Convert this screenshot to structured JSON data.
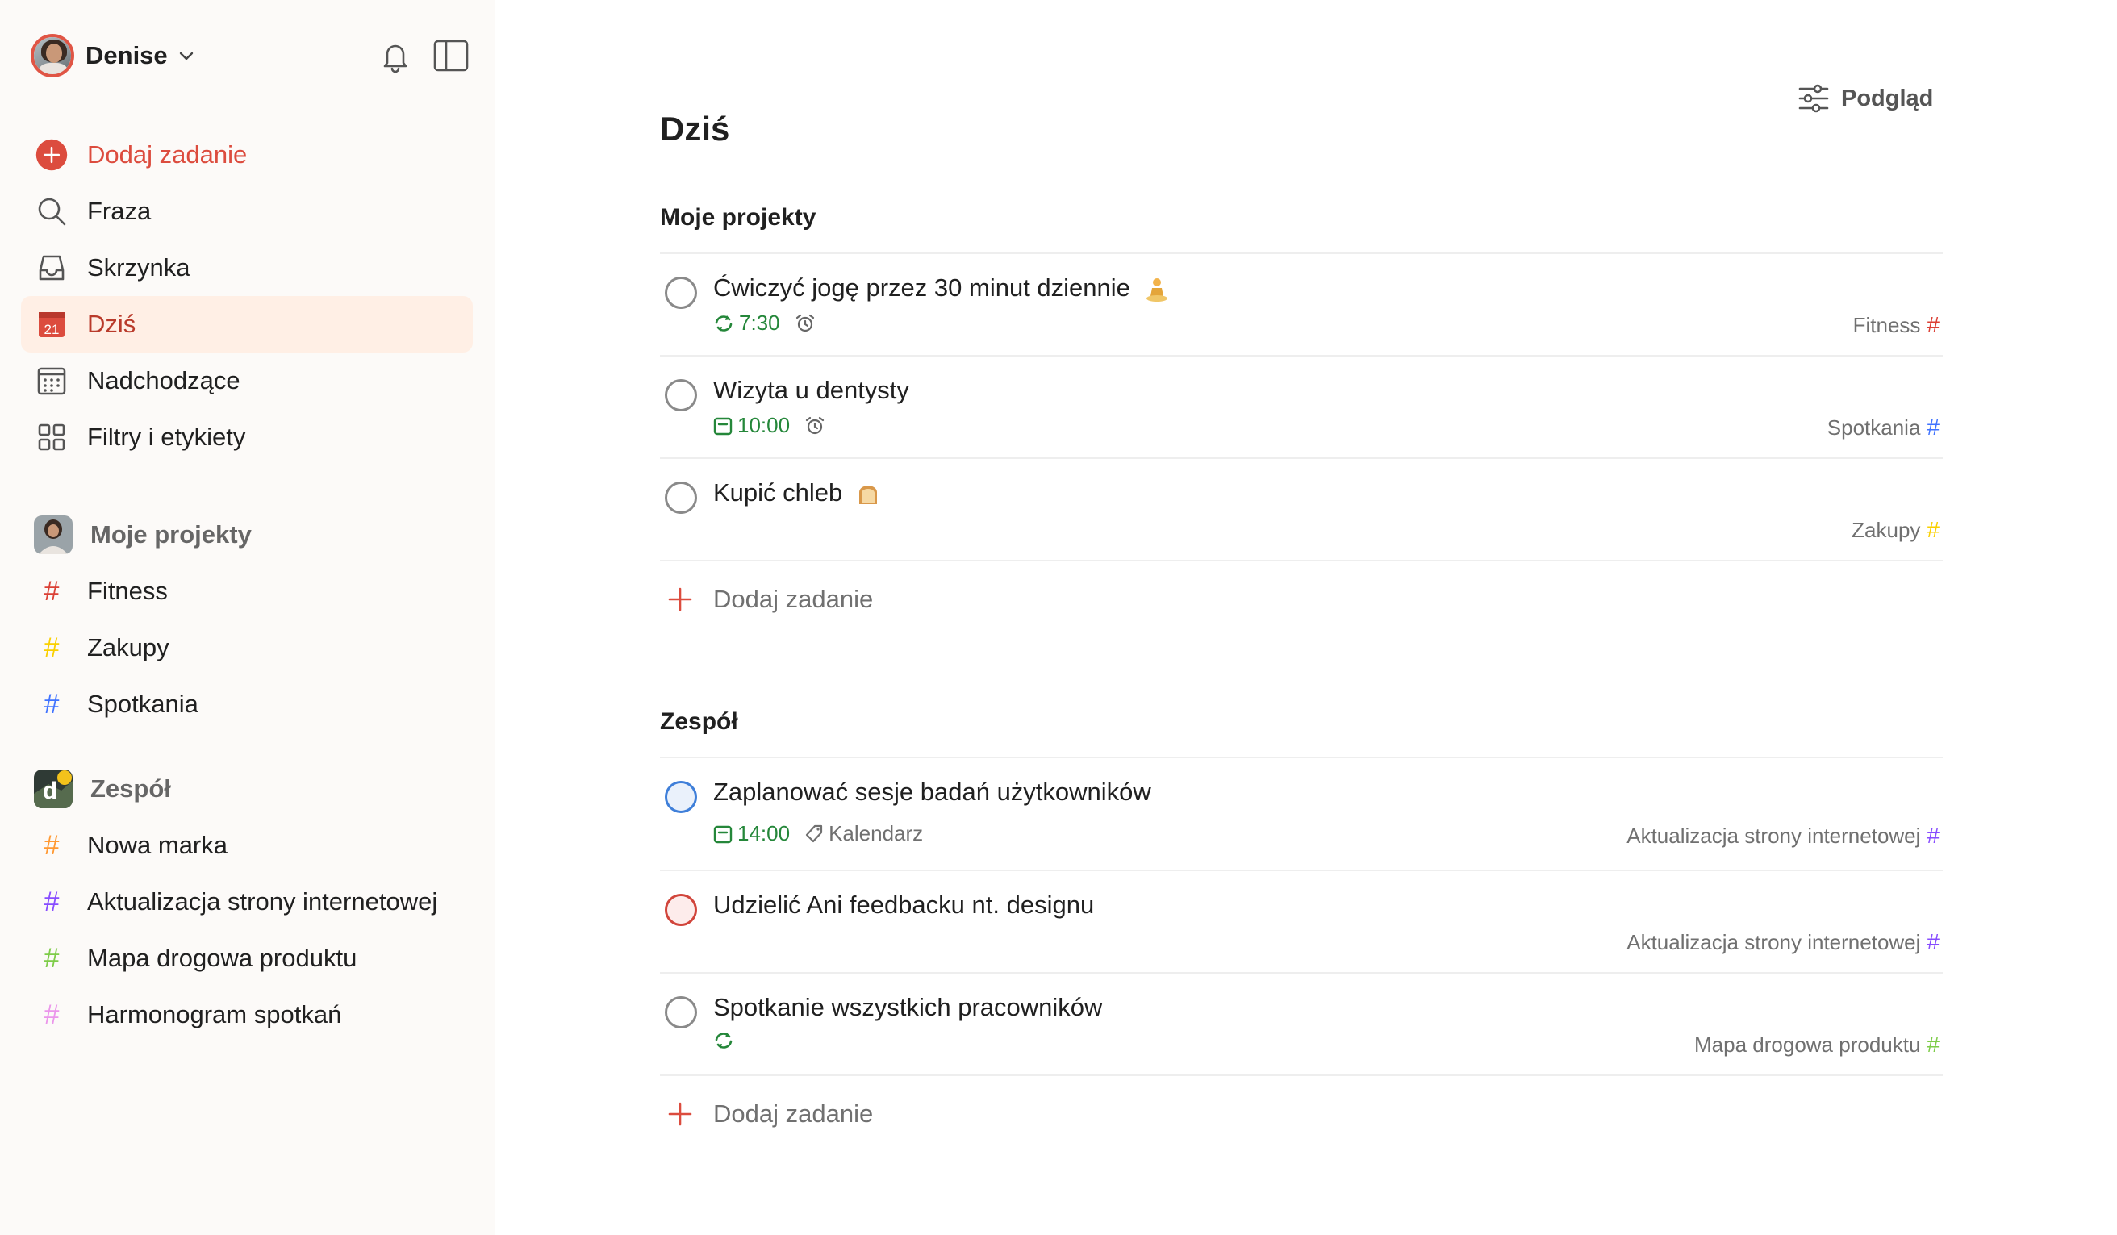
{
  "user": {
    "name": "Denise"
  },
  "nav": {
    "add_task": "Dodaj zadanie",
    "search": "Fraza",
    "inbox": "Skrzynka",
    "today": "Dziś",
    "today_date": "21",
    "upcoming": "Nadchodzące",
    "filters": "Filtry i etykiety"
  },
  "my_projects": {
    "title": "Moje projekty",
    "items": [
      {
        "name": "Fitness",
        "color": "#db4035"
      },
      {
        "name": "Zakupy",
        "color": "#fad000"
      },
      {
        "name": "Spotkania",
        "color": "#4073ff"
      }
    ]
  },
  "team": {
    "title": "Zespół",
    "avatar_letter": "d",
    "items": [
      {
        "name": "Nowa marka",
        "color": "#ff9933"
      },
      {
        "name": "Aktualizacja strony internetowej",
        "color": "#884dff"
      },
      {
        "name": "Mapa drogowa produktu",
        "color": "#7ecc49"
      },
      {
        "name": "Harmonogram spotkań",
        "color": "#eb96eb"
      }
    ]
  },
  "main": {
    "title": "Dziś",
    "view_button": "Podgląd",
    "sections": [
      {
        "title": "Moje projekty",
        "tasks": [
          {
            "title": "Ćwiczyć jogę przez 30 minut dziennie",
            "time": "7:30",
            "project": "Fitness",
            "project_color": "#db4035"
          },
          {
            "title": "Wizyta u dentysty",
            "time": "10:00",
            "project": "Spotkania",
            "project_color": "#4073ff"
          },
          {
            "title": "Kupić chleb",
            "project": "Zakupy",
            "project_color": "#fad000"
          }
        ],
        "add_label": "Dodaj zadanie"
      },
      {
        "title": "Zespół",
        "tasks": [
          {
            "title": "Zaplanować sesje badań użytkowników",
            "time": "14:00",
            "label": "Kalendarz",
            "project": "Aktualizacja strony internetowej",
            "project_color": "#884dff"
          },
          {
            "title": "Udzielić Ani feedbacku nt. designu",
            "project": "Aktualizacja strony internetowej",
            "project_color": "#884dff"
          },
          {
            "title": "Spotkanie wszystkich pracowników",
            "project": "Mapa drogowa produktu",
            "project_color": "#7ecc49"
          }
        ],
        "add_label": "Dodaj zadanie"
      }
    ]
  },
  "colors": {
    "accent": "#dc4c3e",
    "date_green": "#25873a",
    "active_bg": "#ffefe5"
  }
}
